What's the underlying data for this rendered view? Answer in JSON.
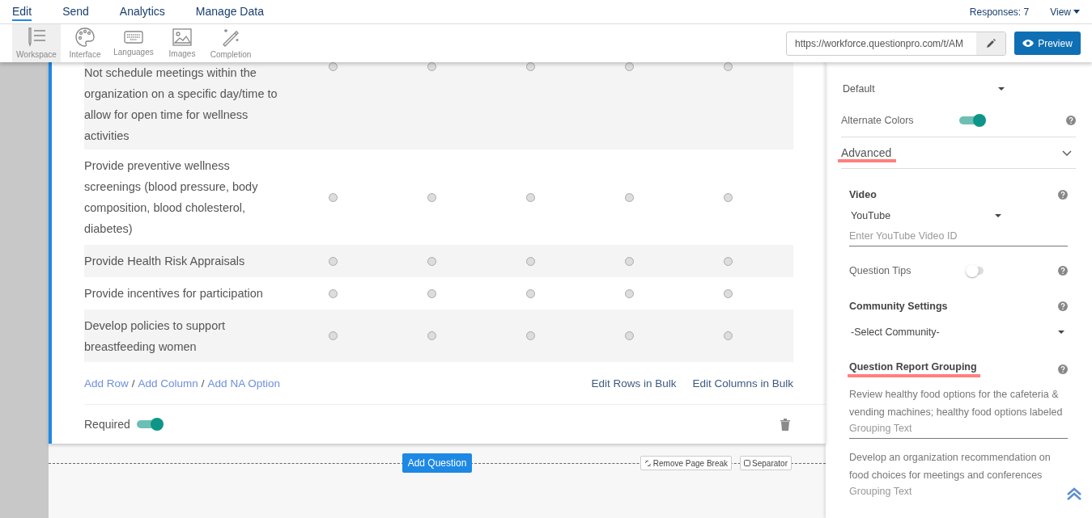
{
  "menu": [
    {
      "label": "Edit",
      "selected": true
    },
    {
      "label": "Send",
      "selected": false
    },
    {
      "label": "Analytics",
      "selected": false
    },
    {
      "label": "Manage Data",
      "selected": false
    }
  ],
  "responses": "Responses: 7",
  "view": "View",
  "toolbar": [
    {
      "label": "Workspace",
      "kind": "workspace",
      "selected": true
    },
    {
      "label": "Interface",
      "kind": "palette",
      "selected": false
    },
    {
      "label": "Languages",
      "kind": "keyboard",
      "selected": false
    },
    {
      "label": "Images",
      "kind": "image",
      "selected": false
    },
    {
      "label": "Completion",
      "kind": "wand",
      "selected": false
    }
  ],
  "url": "https://workforce.questionpro.com/t/AM",
  "preview": "Preview",
  "matrix": {
    "rows": [
      {
        "label": "Not schedule meetings within the organization on a specific day/time to allow for open time for wellness activities",
        "answers": [
          {
            "selected": false
          },
          {
            "selected": false
          },
          {
            "selected": false
          },
          {
            "selected": false
          },
          {
            "selected": false
          }
        ]
      },
      {
        "label": "Provide preventive wellness screenings (blood pressure, body composition, blood cholesterol, diabetes)",
        "answers": [
          {
            "selected": false
          },
          {
            "selected": false
          },
          {
            "selected": false
          },
          {
            "selected": false
          },
          {
            "selected": false
          }
        ]
      },
      {
        "label": "Provide Health Risk Appraisals",
        "answers": [
          {
            "selected": false
          },
          {
            "selected": false
          },
          {
            "selected": false
          },
          {
            "selected": false
          },
          {
            "selected": false
          }
        ]
      },
      {
        "label": "Provide incentives for participation",
        "answers": [
          {
            "selected": false
          },
          {
            "selected": false
          },
          {
            "selected": false
          },
          {
            "selected": false
          },
          {
            "selected": false
          }
        ]
      },
      {
        "label": "Develop policies to support breastfeeding women",
        "answers": [
          {
            "selected": false
          },
          {
            "selected": false
          },
          {
            "selected": false
          },
          {
            "selected": false
          },
          {
            "selected": false
          }
        ]
      }
    ],
    "add_links": [
      "Add Row",
      "Add Column",
      "Add NA Option"
    ],
    "separator": "/",
    "bulk_links": [
      "Edit Rows in Bulk",
      "Edit Columns in Bulk"
    ]
  },
  "required": {
    "label": "Required",
    "on": true
  },
  "add_question": "Add Question",
  "remove_page_break": "Remove Page Break",
  "separator_button": "Separator",
  "panel": {
    "row_display_order": "Default",
    "alternate_colors": {
      "label": "Alternate Colors",
      "on": true
    },
    "advanced": {
      "label": "Advanced",
      "expanded": true
    },
    "video": {
      "label": "Video",
      "value": "YouTube",
      "placeholder": "Enter YouTube Video ID"
    },
    "question_tips": {
      "label": "Question Tips",
      "on": false
    },
    "community": {
      "label": "Community Settings",
      "value": "-Select Community-"
    },
    "grouping": {
      "label": "Question Report Grouping",
      "items": [
        {
          "text": "Review healthy food options for the cafeteria & vending machines; healthy food options labeled",
          "placeholder": "Grouping Text"
        },
        {
          "text": "Develop an organization recommendation on food choices for meetings and conferences",
          "placeholder": "Grouping Text"
        }
      ]
    }
  }
}
